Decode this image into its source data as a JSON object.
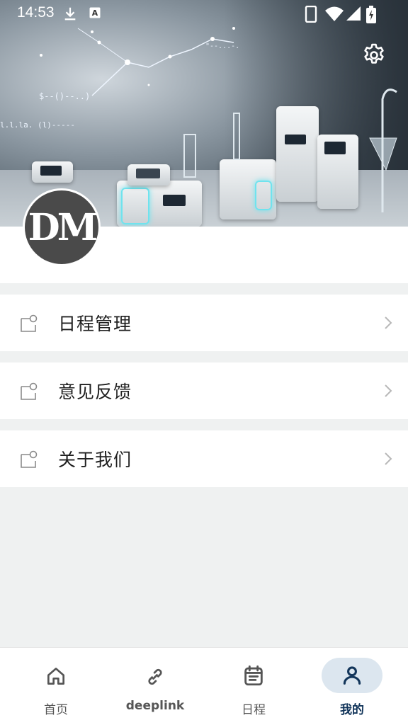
{
  "status_bar": {
    "time": "14:53",
    "icons": [
      "download-icon",
      "text-notification-icon",
      "phone-icon",
      "wifi-icon",
      "cellular-signal-icon",
      "battery-charging-icon"
    ]
  },
  "header": {
    "settings_icon": "gear-icon",
    "avatar_text": "DM"
  },
  "menu": {
    "items": [
      {
        "label": "日程管理",
        "icon": "card-icon"
      },
      {
        "label": "意见反馈",
        "icon": "card-icon"
      },
      {
        "label": "关于我们",
        "icon": "card-icon"
      }
    ]
  },
  "bottom_nav": {
    "items": [
      {
        "label": "首页",
        "icon": "home-icon"
      },
      {
        "label": "deeplink",
        "icon": "link-icon"
      },
      {
        "label": "日程",
        "icon": "calendar-icon"
      },
      {
        "label": "我的",
        "icon": "person-icon"
      }
    ],
    "active_index": 3
  },
  "colors": {
    "active_nav": "#12355a",
    "active_pill": "#dce6ef",
    "page_background": "#eff1f1"
  }
}
